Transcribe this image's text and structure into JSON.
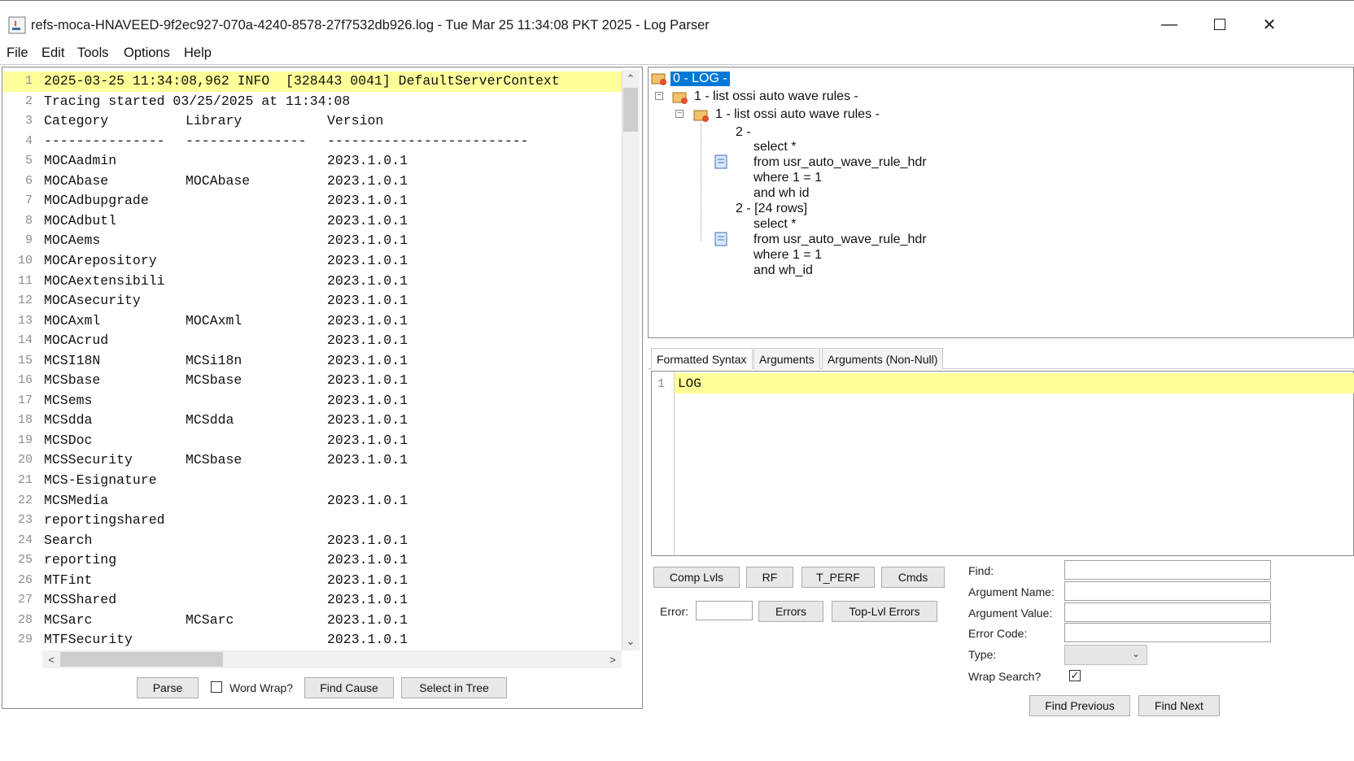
{
  "window": {
    "title": "refs-moca-HNAVEED-9f2ec927-070a-4240-8578-27f7532db926.log - Tue Mar 25 11:34:08 PKT 2025 - Log Parser"
  },
  "menu": [
    "File",
    "Edit",
    "Tools",
    "Options",
    "Help"
  ],
  "log_lines": [
    {
      "n": "1",
      "c1": "2025-03-25 11:34:08,962 INFO  [328443 0041] DefaultServerContext",
      "c2": "",
      "c3": ""
    },
    {
      "n": "2",
      "c1": "Tracing started 03/25/2025 at 11:34:08",
      "c2": "",
      "c3": ""
    },
    {
      "n": "3",
      "c1": "Category",
      "c2": "Library",
      "c3": "Version"
    },
    {
      "n": "4",
      "c1": "---------------",
      "c2": "---------------",
      "c3": "-------------------------"
    },
    {
      "n": "5",
      "c1": "MOCAadmin",
      "c2": "",
      "c3": "2023.1.0.1"
    },
    {
      "n": "6",
      "c1": "MOCAbase",
      "c2": "MOCAbase",
      "c3": "2023.1.0.1"
    },
    {
      "n": "7",
      "c1": "MOCAdbupgrade",
      "c2": "",
      "c3": "2023.1.0.1"
    },
    {
      "n": "8",
      "c1": "MOCAdbutl",
      "c2": "",
      "c3": "2023.1.0.1"
    },
    {
      "n": "9",
      "c1": "MOCAems",
      "c2": "",
      "c3": "2023.1.0.1"
    },
    {
      "n": "10",
      "c1": "MOCArepository",
      "c2": "",
      "c3": "2023.1.0.1"
    },
    {
      "n": "11",
      "c1": "MOCAextensibili",
      "c2": "",
      "c3": "2023.1.0.1"
    },
    {
      "n": "12",
      "c1": "MOCAsecurity",
      "c2": "",
      "c3": "2023.1.0.1"
    },
    {
      "n": "13",
      "c1": "MOCAxml",
      "c2": "MOCAxml",
      "c3": "2023.1.0.1"
    },
    {
      "n": "14",
      "c1": "MOCAcrud",
      "c2": "",
      "c3": "2023.1.0.1"
    },
    {
      "n": "15",
      "c1": "MCSI18N",
      "c2": "MCSi18n",
      "c3": "2023.1.0.1"
    },
    {
      "n": "16",
      "c1": "MCSbase",
      "c2": "MCSbase",
      "c3": "2023.1.0.1"
    },
    {
      "n": "17",
      "c1": "MCSems",
      "c2": "",
      "c3": "2023.1.0.1"
    },
    {
      "n": "18",
      "c1": "MCSdda",
      "c2": "MCSdda",
      "c3": "2023.1.0.1"
    },
    {
      "n": "19",
      "c1": "MCSDoc",
      "c2": "",
      "c3": "2023.1.0.1"
    },
    {
      "n": "20",
      "c1": "MCSSecurity",
      "c2": "MCSbase",
      "c3": "2023.1.0.1"
    },
    {
      "n": "21",
      "c1": "MCS-Esignature",
      "c2": "",
      "c3": ""
    },
    {
      "n": "22",
      "c1": "MCSMedia",
      "c2": "",
      "c3": "2023.1.0.1"
    },
    {
      "n": "23",
      "c1": "reportingshared",
      "c2": "",
      "c3": ""
    },
    {
      "n": "24",
      "c1": "Search",
      "c2": "",
      "c3": "2023.1.0.1"
    },
    {
      "n": "25",
      "c1": "reporting",
      "c2": "",
      "c3": "2023.1.0.1"
    },
    {
      "n": "26",
      "c1": "MTFint",
      "c2": "",
      "c3": "2023.1.0.1"
    },
    {
      "n": "27",
      "c1": "MCSShared",
      "c2": "",
      "c3": "2023.1.0.1"
    },
    {
      "n": "28",
      "c1": "MCSarc",
      "c2": "MCSarc",
      "c3": "2023.1.0.1"
    },
    {
      "n": "29",
      "c1": "MTFSecurity",
      "c2": "",
      "c3": "2023.1.0.1"
    }
  ],
  "left_buttons": {
    "parse": "Parse",
    "word_wrap": "Word Wrap?",
    "find_cause": "Find Cause",
    "select_in_tree": "Select in Tree"
  },
  "tree": {
    "root": "0 - LOG -",
    "n1": "1 - list ossi auto wave rules -",
    "n1b": "1 - list ossi auto wave rules -",
    "q1_label": "2 -",
    "q1_lines": [
      "select *",
      "from usr_auto_wave_rule_hdr",
      "where 1 = 1",
      "and wh  id"
    ],
    "q2_label": "2 - [24 rows]",
    "q2_lines": [
      "select *",
      "from usr_auto_wave_rule_hdr",
      "where 1 = 1",
      "and wh_id"
    ]
  },
  "tabs": [
    "Formatted Syntax",
    "Arguments",
    "Arguments (Non-Null)"
  ],
  "syntax": {
    "line": "1",
    "text": "LOG"
  },
  "bottom_buttons": {
    "comp_lvls": "Comp Lvls",
    "rf": "RF",
    "t_perf": "T_PERF",
    "cmds": "Cmds",
    "error_label": "Error:",
    "errors": "Errors",
    "top_lvl_errors": "Top-Lvl Errors"
  },
  "find_form": {
    "find": "Find:",
    "argument_name": "Argument Name:",
    "argument_value": "Argument Value:",
    "error_code": "Error Code:",
    "type": "Type:",
    "wrap_search": "Wrap Search?",
    "find_previous": "Find Previous",
    "find_next": "Find Next"
  },
  "colors": {
    "highlight": "#ffff99",
    "selection": "#0078d7"
  }
}
